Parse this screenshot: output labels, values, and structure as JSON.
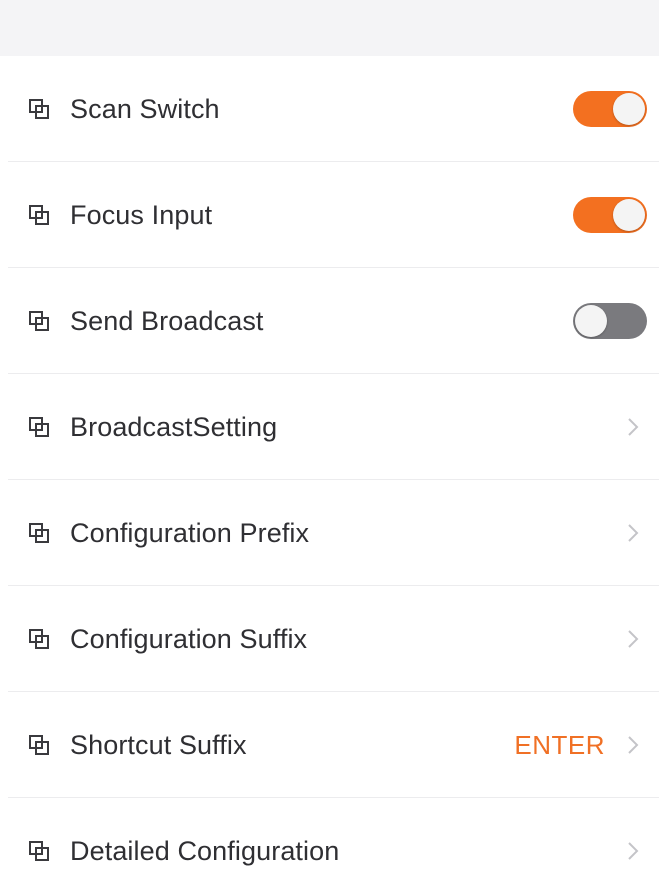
{
  "colors": {
    "accent": "#f37020",
    "toggle_off": "#7a7a7e",
    "value_text": "#f07025",
    "label_text": "#2f2f33",
    "chevron": "#c4c4c8",
    "divider": "#ececee"
  },
  "settings": {
    "items": [
      {
        "label": "Scan Switch",
        "icon": "copy-icon",
        "control": "toggle",
        "toggle_on": true
      },
      {
        "label": "Focus Input",
        "icon": "copy-icon",
        "control": "toggle",
        "toggle_on": true
      },
      {
        "label": "Send Broadcast",
        "icon": "copy-icon",
        "control": "toggle",
        "toggle_on": false
      },
      {
        "label": "BroadcastSetting",
        "icon": "copy-icon",
        "control": "chevron"
      },
      {
        "label": "Configuration Prefix",
        "icon": "copy-icon",
        "control": "chevron"
      },
      {
        "label": "Configuration Suffix",
        "icon": "copy-icon",
        "control": "chevron"
      },
      {
        "label": "Shortcut Suffix",
        "icon": "copy-icon",
        "control": "chevron",
        "value": "ENTER"
      },
      {
        "label": "Detailed Configuration",
        "icon": "copy-icon",
        "control": "chevron"
      }
    ]
  }
}
